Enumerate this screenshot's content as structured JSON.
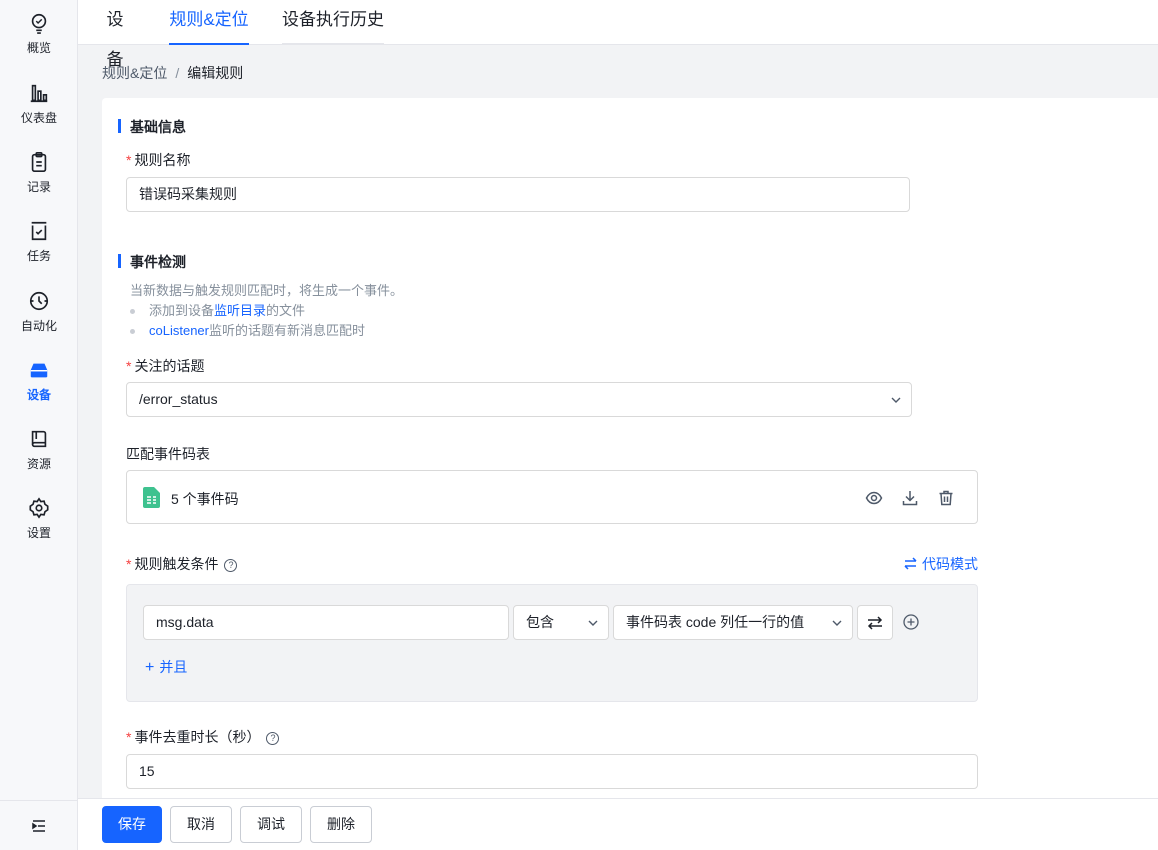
{
  "sidebar": {
    "items": [
      {
        "label": "概览",
        "icon": "bulb-icon"
      },
      {
        "label": "仪表盘",
        "icon": "bar-chart-icon"
      },
      {
        "label": "记录",
        "icon": "clipboard-icon"
      },
      {
        "label": "任务",
        "icon": "task-icon"
      },
      {
        "label": "自动化",
        "icon": "automation-icon"
      },
      {
        "label": "设备",
        "icon": "device-icon",
        "active": true
      },
      {
        "label": "资源",
        "icon": "book-icon"
      },
      {
        "label": "设置",
        "icon": "gear-icon"
      }
    ]
  },
  "tabs": [
    "设备",
    "规则&定位",
    "设备执行历史"
  ],
  "active_tab": "规则&定位",
  "breadcrumb": {
    "parent": "规则&定位",
    "separator": "/",
    "current": "编辑规则"
  },
  "basic": {
    "section_title": "基础信息",
    "rule_name_label": "规则名称",
    "rule_name_value": "错误码采集规则"
  },
  "event": {
    "section_title": "事件检测",
    "desc": "当新数据与触发规则匹配时，将生成一个事件。",
    "bullet1_prefix": "添加到设备",
    "bullet1_link": "监听目录",
    "bullet1_suffix": "的文件",
    "bullet2_link": "coListener",
    "bullet2_suffix": "监听的话题有新消息匹配时",
    "topic_label": "关注的话题",
    "topic_value": "/error_status",
    "code_table_label": "匹配事件码表",
    "code_table_value": "5 个事件码",
    "condition_label": "规则触发条件",
    "code_mode": "代码模式",
    "cond_field": "msg.data",
    "cond_operator": "包含",
    "cond_value": "事件码表 code 列任一行的值",
    "and_label": "并且",
    "dedup_label": "事件去重时长（秒）",
    "dedup_value": "15"
  },
  "footer": {
    "save": "保存",
    "cancel": "取消",
    "debug": "调试",
    "delete": "删除"
  },
  "colors": {
    "accent": "#1664ff",
    "required": "#f53f3f",
    "file_icon": "#3ec28f"
  }
}
